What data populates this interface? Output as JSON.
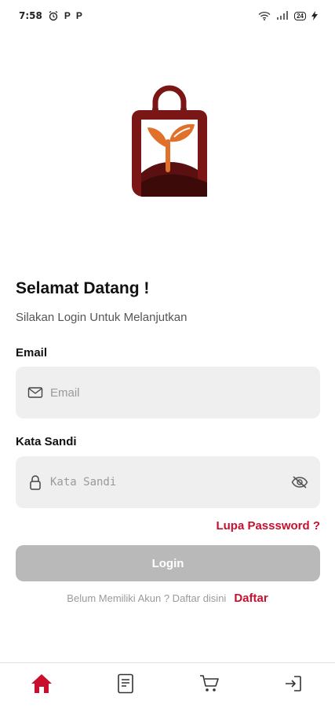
{
  "status_bar": {
    "time": "7:58",
    "notif_p1": "P",
    "notif_p2": "P",
    "battery": "24"
  },
  "welcome": {
    "title": "Selamat Datang !",
    "subtitle": "Silakan Login Untuk Melanjutkan"
  },
  "email": {
    "label": "Email",
    "placeholder": "Email",
    "value": ""
  },
  "password": {
    "label": "Kata Sandi",
    "placeholder": "Kata Sandi",
    "value": ""
  },
  "forgot_password": "Lupa Passsword ?",
  "login_button": "Login",
  "register": {
    "prompt": "Belum Memiliki Akun ? Daftar disini",
    "link": "Daftar"
  },
  "bottom_nav": [
    {
      "icon": "home-icon",
      "active": true
    },
    {
      "icon": "document-icon",
      "active": false
    },
    {
      "icon": "cart-icon",
      "active": false
    },
    {
      "icon": "login-icon",
      "active": false
    }
  ],
  "colors": {
    "accent": "#c8102e",
    "logo_dark": "#6e1414",
    "logo_orange": "#e0702a",
    "button_disabled": "#b9b9b9",
    "input_bg": "#efefef"
  }
}
